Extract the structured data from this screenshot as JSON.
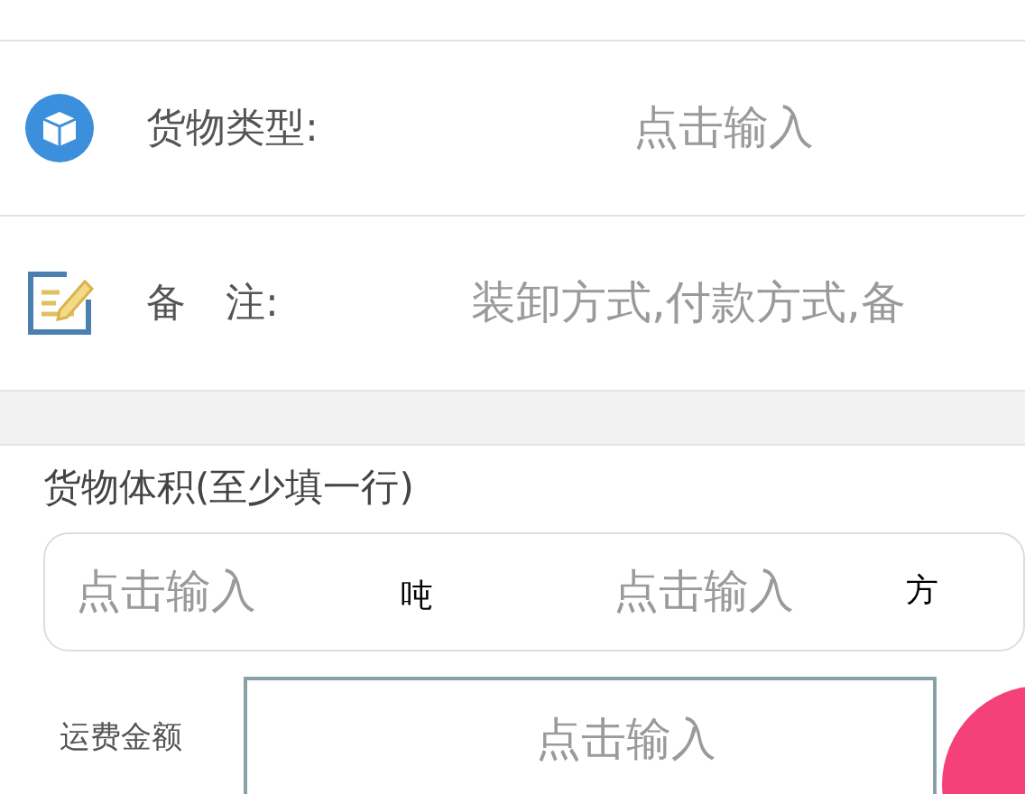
{
  "rows": [
    {
      "kind": "cargo",
      "label": "货物类型:",
      "placeholder": "点击输入"
    },
    {
      "kind": "note",
      "label": "备　注:",
      "placeholder": "装卸方式,付款方式,备"
    }
  ],
  "volume": {
    "title": "货物体积(至少填一行)",
    "fields": [
      {
        "placeholder": "点击输入",
        "unit": "吨"
      },
      {
        "placeholder": "点击输入",
        "unit": "方"
      }
    ]
  },
  "fee": {
    "label": "运费金额",
    "placeholder": "点击输入"
  }
}
